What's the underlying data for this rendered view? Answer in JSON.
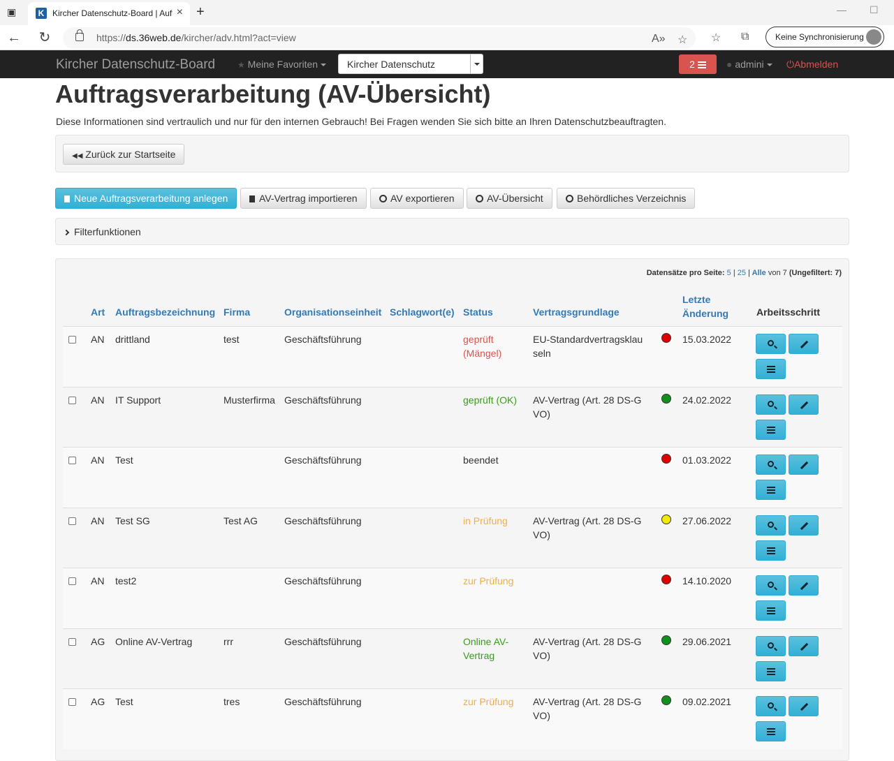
{
  "browser": {
    "tab_title": "Kircher Datenschutz-Board | Auftr",
    "url_prefix": "https://",
    "url_domain": "ds.36web.de",
    "url_path": "/kircher/adv.html?act=view",
    "sync_label": "Keine Synchronisierung"
  },
  "navbar": {
    "brand": "Kircher Datenschutz-Board",
    "favorites": "Meine Favoriten",
    "org_select": "Kircher Datenschutz",
    "badge_count": "2",
    "user": "admini",
    "logout": "Abmelden"
  },
  "page": {
    "title": "Auftragsverarbeitung (AV-Übersicht)",
    "subtitle": "Diese Informationen sind vertraulich und nur für den internen Gebrauch! Bei Fragen wenden Sie sich bitte an Ihren Datenschutzbeauftragten.",
    "back_button": "Zurück zur Startseite",
    "filter_label": "Filterfunktionen"
  },
  "actions": {
    "new": "Neue Auftragsverarbeitung anlegen",
    "import": "AV-Vertrag importieren",
    "export": "AV exportieren",
    "overview": "AV-Übersicht",
    "registry": "Behördliches Verzeichnis"
  },
  "paging": {
    "label": "Datensätze pro Seite:",
    "opt5": "5",
    "sep1": "|",
    "opt25": "25",
    "sep2": "|",
    "all": "Alle",
    "of": "von 7",
    "unfiltered": "(Ungefiltert: 7)"
  },
  "table": {
    "headers": {
      "art": "Art",
      "bezeichnung": "Auftragsbezeichnung",
      "firma": "Firma",
      "org": "Organisationseinheit",
      "tags": "Schlagwort(e)",
      "status": "Status",
      "grundlage": "Vertragsgrundlage",
      "changed": "Letzte Änderung",
      "step": "Arbeitsschritt"
    },
    "rows": [
      {
        "art": "AN",
        "name": "drittland",
        "firma": "test",
        "org": "Geschäftsführung",
        "tags": "",
        "status": "geprüft (Mängel)",
        "status_color": "#d9534f",
        "basis": "EU-Standardvertragsklauseln",
        "light": "#e00000",
        "date": "15.03.2022"
      },
      {
        "art": "AN",
        "name": "IT Support",
        "firma": "Musterfirma",
        "org": "Geschäftsführung",
        "tags": "",
        "status": "geprüft (OK)",
        "status_color": "#3c9a1e",
        "basis": "AV-Vertrag (Art. 28 DS-GVO)",
        "light": "#10901c",
        "date": "24.02.2022"
      },
      {
        "art": "AN",
        "name": "Test",
        "firma": "",
        "org": "Geschäftsführung",
        "tags": "",
        "status": "beendet",
        "status_color": "#333333",
        "basis": "",
        "light": "#e00000",
        "date": "01.03.2022"
      },
      {
        "art": "AN",
        "name": "Test SG",
        "firma": "Test AG",
        "org": "Geschäftsführung",
        "tags": "",
        "status": "in Prüfung",
        "status_color": "#f0ad4e",
        "basis": "AV-Vertrag (Art. 28 DS-GVO)",
        "light": "#f2ea00",
        "date": "27.06.2022"
      },
      {
        "art": "AN",
        "name": "test2",
        "firma": "",
        "org": "Geschäftsführung",
        "tags": "",
        "status": "zur Prüfung",
        "status_color": "#f0ad4e",
        "basis": "",
        "light": "#e00000",
        "date": "14.10.2020"
      },
      {
        "art": "AG",
        "name": "Online AV-Vertrag",
        "firma": "rrr",
        "org": "Geschäftsführung",
        "tags": "",
        "status": "Online AV-Vertrag",
        "status_color": "#3c9a1e",
        "basis": "AV-Vertrag (Art. 28 DS-GVO)",
        "light": "#10901c",
        "date": "29.06.2021"
      },
      {
        "art": "AG",
        "name": "Test",
        "firma": "tres",
        "org": "Geschäftsführung",
        "tags": "",
        "status": "zur Prüfung",
        "status_color": "#f0ad4e",
        "basis": "AV-Vertrag (Art. 28 DS-GVO)",
        "light": "#10901c",
        "date": "09.02.2021"
      }
    ]
  }
}
